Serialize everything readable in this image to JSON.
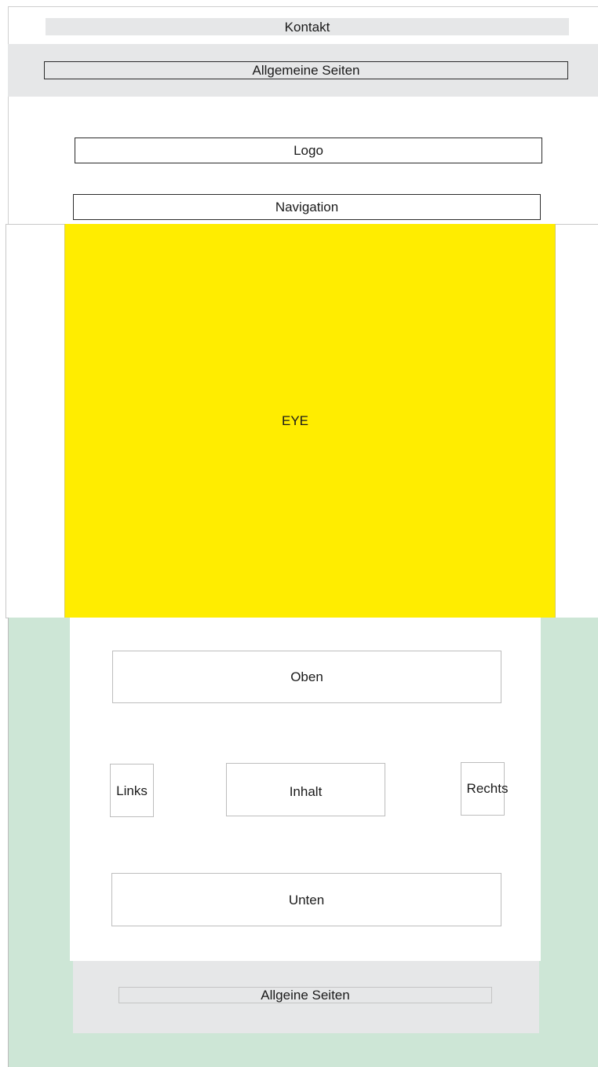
{
  "header": {
    "kontakt": "Kontakt",
    "allgemeine_seiten": "Allgemeine Seiten",
    "logo": "Logo",
    "navigation": "Navigation"
  },
  "hero": {
    "label": "EYE",
    "color": "#ffed00"
  },
  "content": {
    "oben": "Oben",
    "links": "Links",
    "inhalt": "Inhalt",
    "rechts": "Rechts",
    "unten": "Unten",
    "background_color": "#cde6d6"
  },
  "footer": {
    "allgeine_seiten": "Allgeine Seiten"
  },
  "colors": {
    "grey_band": "#e6e7e8"
  }
}
